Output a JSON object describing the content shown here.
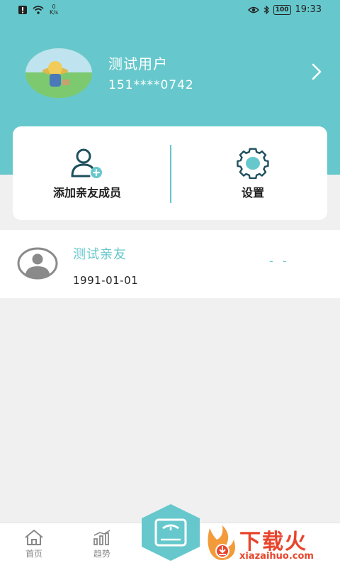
{
  "status_bar": {
    "net_speed_value": "0",
    "net_speed_unit": "K/s",
    "battery": "100",
    "time": "19:33"
  },
  "profile": {
    "name": "测试用户",
    "phone": "151****0742"
  },
  "actions": {
    "add_member_label": "添加亲友成员",
    "settings_label": "设置"
  },
  "members": [
    {
      "name": "测试亲友",
      "birth_date": "1991-01-01",
      "value": "- -"
    }
  ],
  "tabbar": {
    "home_label": "首页",
    "trend_label": "趋势"
  },
  "watermark": {
    "title": "下载火",
    "subtitle": "xiazaihuo.com"
  },
  "colors": {
    "accent": "#66c8cc",
    "watermark": "#e8452c"
  }
}
